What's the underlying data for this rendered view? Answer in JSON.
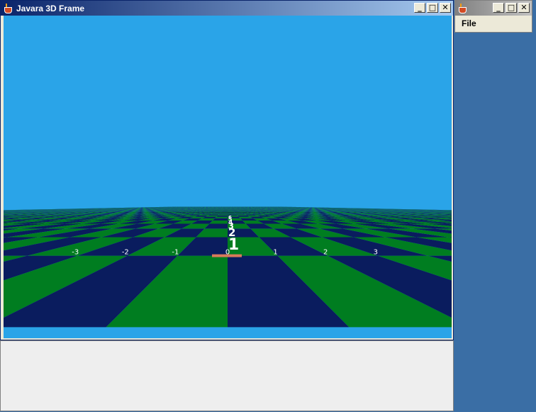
{
  "main_window": {
    "title": "Javara 3D Frame",
    "controls": {
      "minimize": "_",
      "maximize": "□",
      "close": "✕"
    }
  },
  "file_window": {
    "controls": {
      "minimize": "_",
      "maximize": "□",
      "close": "✕"
    },
    "menu": {
      "file": "File"
    }
  },
  "scene": {
    "sky_color": "#2aa4e8",
    "tile_color_a": "#007d20",
    "tile_color_b": "#0a1c5e",
    "marker_color": "#d97a5a",
    "x_axis_labels": [
      "-3",
      "-2",
      "-1",
      "0",
      "1",
      "2",
      "3"
    ],
    "z_axis_labels": [
      "1",
      "2",
      "3",
      "4",
      "5",
      "6"
    ]
  },
  "icons": [
    "java-cup-icon",
    "minimize-icon",
    "maximize-icon",
    "close-icon"
  ]
}
